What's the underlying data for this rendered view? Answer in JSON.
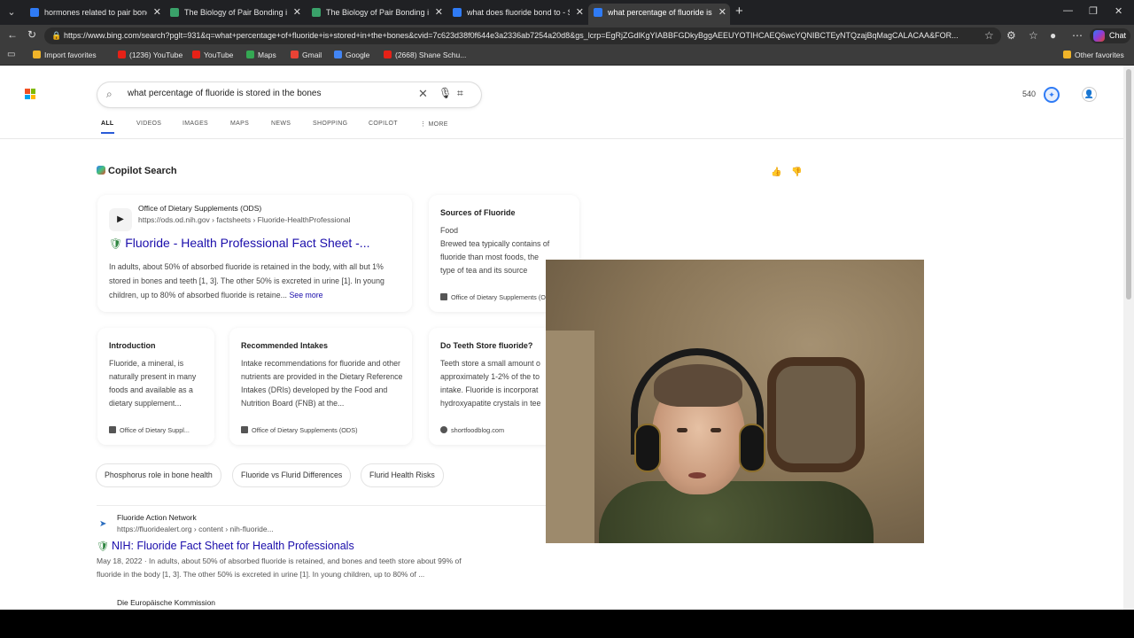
{
  "browser": {
    "tabs": [
      {
        "label": "hormones related to pair bonding",
        "active": false
      },
      {
        "label": "The Biology of Pair Bonding in Hu",
        "active": false
      },
      {
        "label": "The Biology of Pair Bonding in Hu",
        "active": false
      },
      {
        "label": "what does fluoride bond to - Sear",
        "active": false
      },
      {
        "label": "what percentage of fluoride is sto",
        "active": true
      }
    ],
    "url": "https://www.bing.com/search?pglt=931&q=what+percentage+of+fluoride+is+stored+in+the+bones&cvid=7c623d38f0f644e3a2336ab7254a20d8&gs_lcrp=EgRjZGdlKgYIABBFGDkyBggAEEUYOTIHCAEQ6wcYQNIBCTEyNTQzajBqMagCALACAA&FOR...",
    "chat_label": "Chat",
    "bookmarks": [
      {
        "label": "Import favorites",
        "color": "#f0b429"
      },
      {
        "label": "(1236) YouTube",
        "color": "#e62117"
      },
      {
        "label": "YouTube",
        "color": "#e62117"
      },
      {
        "label": "Maps",
        "color": "#34a853"
      },
      {
        "label": "Gmail",
        "color": "#ea4335"
      },
      {
        "label": "Google",
        "color": "#4285f4"
      },
      {
        "label": "(2668) Shane Schu...",
        "color": "#e62117"
      }
    ],
    "other_favorites": "Other favorites"
  },
  "search": {
    "query": "what percentage of fluoride is stored in the bones",
    "rewards_points": "540",
    "verticals": [
      "ALL",
      "VIDEOS",
      "IMAGES",
      "MAPS",
      "NEWS",
      "SHOPPING",
      "COPILOT",
      "⋮ MORE"
    ]
  },
  "copilot": {
    "title": "Copilot Search",
    "main_card": {
      "source_name": "Office of Dietary Supplements (ODS)",
      "source_url": "https://ods.od.nih.gov › factsheets › Fluoride-HealthProfessional",
      "title": "Fluoride - Health Professional Fact Sheet -...",
      "snippet": "In adults, about 50% of absorbed fluoride is retained in the body, with all but 1% stored in bones and teeth [1, 3]. The other 50% is excreted in urine [1]. In young children, up to 80% of absorbed fluoride is retaine...",
      "see_more": "See more"
    },
    "side_card": {
      "title": "Sources of Fluoride",
      "sub": "Food",
      "body": "Brewed tea typically contains of fluoride than most foods, the type of tea and its source",
      "source": "Office of Dietary Supplements (O"
    },
    "cards": [
      {
        "title": "Introduction",
        "body": "Fluoride, a mineral, is naturally present in many foods and available as a dietary supplement...",
        "source": "Office of Dietary Suppl..."
      },
      {
        "title": "Recommended Intakes",
        "body": "Intake recommendations for fluoride and other nutrients are provided in the Dietary Reference Intakes (DRIs) developed by the Food and Nutrition Board (FNB) at the...",
        "source": "Office of Dietary Supplements (ODS)"
      },
      {
        "title": "Do Teeth Store fluoride?",
        "body": "Teeth store a small amount o approximately 1-2% of the to intake. Fluoride is incorporat hydroxyapatite crystals in tee",
        "source": "shortfoodblog.com"
      }
    ],
    "chips": [
      "Phosphorus role in bone health",
      "Fluoride vs Flurid Differences",
      "Flurid Health Risks"
    ]
  },
  "results": [
    {
      "source_name": "Fluoride Action Network",
      "source_url": "https://fluoridealert.org › content › nih-fluoride...",
      "title": "NIH: Fluoride Fact Sheet for Health Professionals",
      "snippet": "May 18, 2022 · In adults, about 50% of absorbed fluoride is retained, and bones and teeth store about 99% of fluoride in the body [1, 3]. The other 50% is excreted in urine [1]. In young children, up to 80% of ..."
    },
    {
      "source_name": "Die Europäische Kommission"
    }
  ]
}
